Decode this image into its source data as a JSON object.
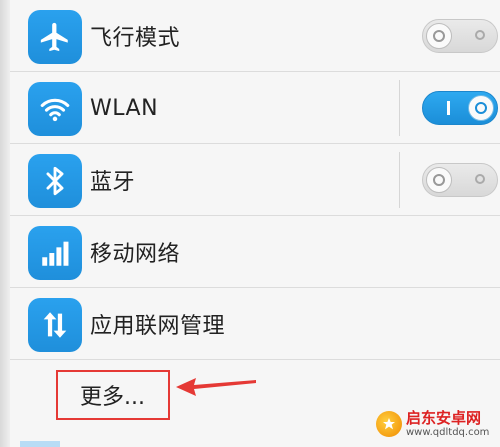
{
  "rows": [
    {
      "label": "飞行模式",
      "icon": "airplane-icon",
      "toggle": "off"
    },
    {
      "label": "WLAN",
      "icon": "wifi-icon",
      "toggle": "on"
    },
    {
      "label": "蓝牙",
      "icon": "bluetooth-icon",
      "toggle": "off"
    },
    {
      "label": "移动网络",
      "icon": "signal-bars-icon",
      "toggle": null
    },
    {
      "label": "应用联网管理",
      "icon": "data-arrows-icon",
      "toggle": null
    }
  ],
  "more": {
    "label": "更多..."
  },
  "colors": {
    "accent": "#1f8fdb",
    "highlight": "#e53935"
  },
  "watermark": {
    "title": "启东安卓网",
    "url": "www.qdltdq.com"
  }
}
